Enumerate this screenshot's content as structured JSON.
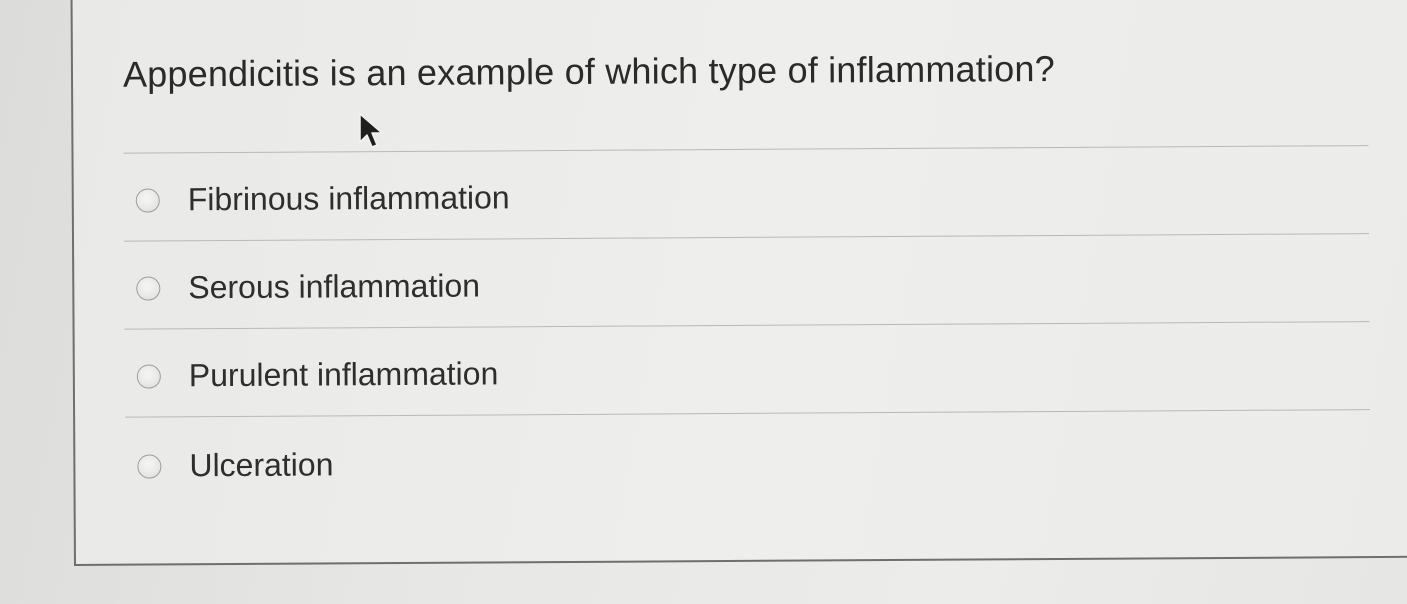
{
  "question": {
    "text": "Appendicitis is an example of which type of inflammation?"
  },
  "options": [
    {
      "label": "Fibrinous inflammation",
      "selected": false
    },
    {
      "label": "Serous inflammation",
      "selected": false
    },
    {
      "label": "Purulent inflammation",
      "selected": false
    },
    {
      "label": "Ulceration",
      "selected": false
    }
  ],
  "cursor": {
    "icon": "arrow-cursor-icon"
  }
}
